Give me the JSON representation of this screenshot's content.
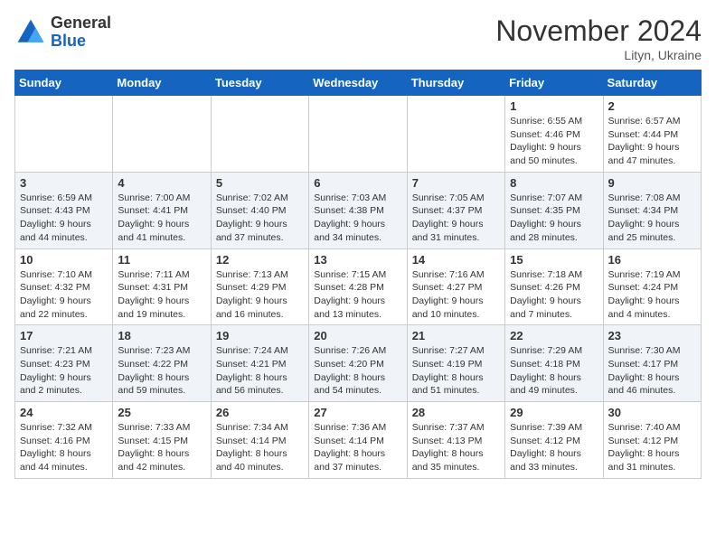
{
  "logo": {
    "general": "General",
    "blue": "Blue"
  },
  "title": "November 2024",
  "subtitle": "Lityn, Ukraine",
  "weekdays": [
    "Sunday",
    "Monday",
    "Tuesday",
    "Wednesday",
    "Thursday",
    "Friday",
    "Saturday"
  ],
  "weeks": [
    [
      {
        "day": "",
        "info": ""
      },
      {
        "day": "",
        "info": ""
      },
      {
        "day": "",
        "info": ""
      },
      {
        "day": "",
        "info": ""
      },
      {
        "day": "",
        "info": ""
      },
      {
        "day": "1",
        "info": "Sunrise: 6:55 AM\nSunset: 4:46 PM\nDaylight: 9 hours\nand 50 minutes."
      },
      {
        "day": "2",
        "info": "Sunrise: 6:57 AM\nSunset: 4:44 PM\nDaylight: 9 hours\nand 47 minutes."
      }
    ],
    [
      {
        "day": "3",
        "info": "Sunrise: 6:59 AM\nSunset: 4:43 PM\nDaylight: 9 hours\nand 44 minutes."
      },
      {
        "day": "4",
        "info": "Sunrise: 7:00 AM\nSunset: 4:41 PM\nDaylight: 9 hours\nand 41 minutes."
      },
      {
        "day": "5",
        "info": "Sunrise: 7:02 AM\nSunset: 4:40 PM\nDaylight: 9 hours\nand 37 minutes."
      },
      {
        "day": "6",
        "info": "Sunrise: 7:03 AM\nSunset: 4:38 PM\nDaylight: 9 hours\nand 34 minutes."
      },
      {
        "day": "7",
        "info": "Sunrise: 7:05 AM\nSunset: 4:37 PM\nDaylight: 9 hours\nand 31 minutes."
      },
      {
        "day": "8",
        "info": "Sunrise: 7:07 AM\nSunset: 4:35 PM\nDaylight: 9 hours\nand 28 minutes."
      },
      {
        "day": "9",
        "info": "Sunrise: 7:08 AM\nSunset: 4:34 PM\nDaylight: 9 hours\nand 25 minutes."
      }
    ],
    [
      {
        "day": "10",
        "info": "Sunrise: 7:10 AM\nSunset: 4:32 PM\nDaylight: 9 hours\nand 22 minutes."
      },
      {
        "day": "11",
        "info": "Sunrise: 7:11 AM\nSunset: 4:31 PM\nDaylight: 9 hours\nand 19 minutes."
      },
      {
        "day": "12",
        "info": "Sunrise: 7:13 AM\nSunset: 4:29 PM\nDaylight: 9 hours\nand 16 minutes."
      },
      {
        "day": "13",
        "info": "Sunrise: 7:15 AM\nSunset: 4:28 PM\nDaylight: 9 hours\nand 13 minutes."
      },
      {
        "day": "14",
        "info": "Sunrise: 7:16 AM\nSunset: 4:27 PM\nDaylight: 9 hours\nand 10 minutes."
      },
      {
        "day": "15",
        "info": "Sunrise: 7:18 AM\nSunset: 4:26 PM\nDaylight: 9 hours\nand 7 minutes."
      },
      {
        "day": "16",
        "info": "Sunrise: 7:19 AM\nSunset: 4:24 PM\nDaylight: 9 hours\nand 4 minutes."
      }
    ],
    [
      {
        "day": "17",
        "info": "Sunrise: 7:21 AM\nSunset: 4:23 PM\nDaylight: 9 hours\nand 2 minutes."
      },
      {
        "day": "18",
        "info": "Sunrise: 7:23 AM\nSunset: 4:22 PM\nDaylight: 8 hours\nand 59 minutes."
      },
      {
        "day": "19",
        "info": "Sunrise: 7:24 AM\nSunset: 4:21 PM\nDaylight: 8 hours\nand 56 minutes."
      },
      {
        "day": "20",
        "info": "Sunrise: 7:26 AM\nSunset: 4:20 PM\nDaylight: 8 hours\nand 54 minutes."
      },
      {
        "day": "21",
        "info": "Sunrise: 7:27 AM\nSunset: 4:19 PM\nDaylight: 8 hours\nand 51 minutes."
      },
      {
        "day": "22",
        "info": "Sunrise: 7:29 AM\nSunset: 4:18 PM\nDaylight: 8 hours\nand 49 minutes."
      },
      {
        "day": "23",
        "info": "Sunrise: 7:30 AM\nSunset: 4:17 PM\nDaylight: 8 hours\nand 46 minutes."
      }
    ],
    [
      {
        "day": "24",
        "info": "Sunrise: 7:32 AM\nSunset: 4:16 PM\nDaylight: 8 hours\nand 44 minutes."
      },
      {
        "day": "25",
        "info": "Sunrise: 7:33 AM\nSunset: 4:15 PM\nDaylight: 8 hours\nand 42 minutes."
      },
      {
        "day": "26",
        "info": "Sunrise: 7:34 AM\nSunset: 4:14 PM\nDaylight: 8 hours\nand 40 minutes."
      },
      {
        "day": "27",
        "info": "Sunrise: 7:36 AM\nSunset: 4:14 PM\nDaylight: 8 hours\nand 37 minutes."
      },
      {
        "day": "28",
        "info": "Sunrise: 7:37 AM\nSunset: 4:13 PM\nDaylight: 8 hours\nand 35 minutes."
      },
      {
        "day": "29",
        "info": "Sunrise: 7:39 AM\nSunset: 4:12 PM\nDaylight: 8 hours\nand 33 minutes."
      },
      {
        "day": "30",
        "info": "Sunrise: 7:40 AM\nSunset: 4:12 PM\nDaylight: 8 hours\nand 31 minutes."
      }
    ]
  ]
}
